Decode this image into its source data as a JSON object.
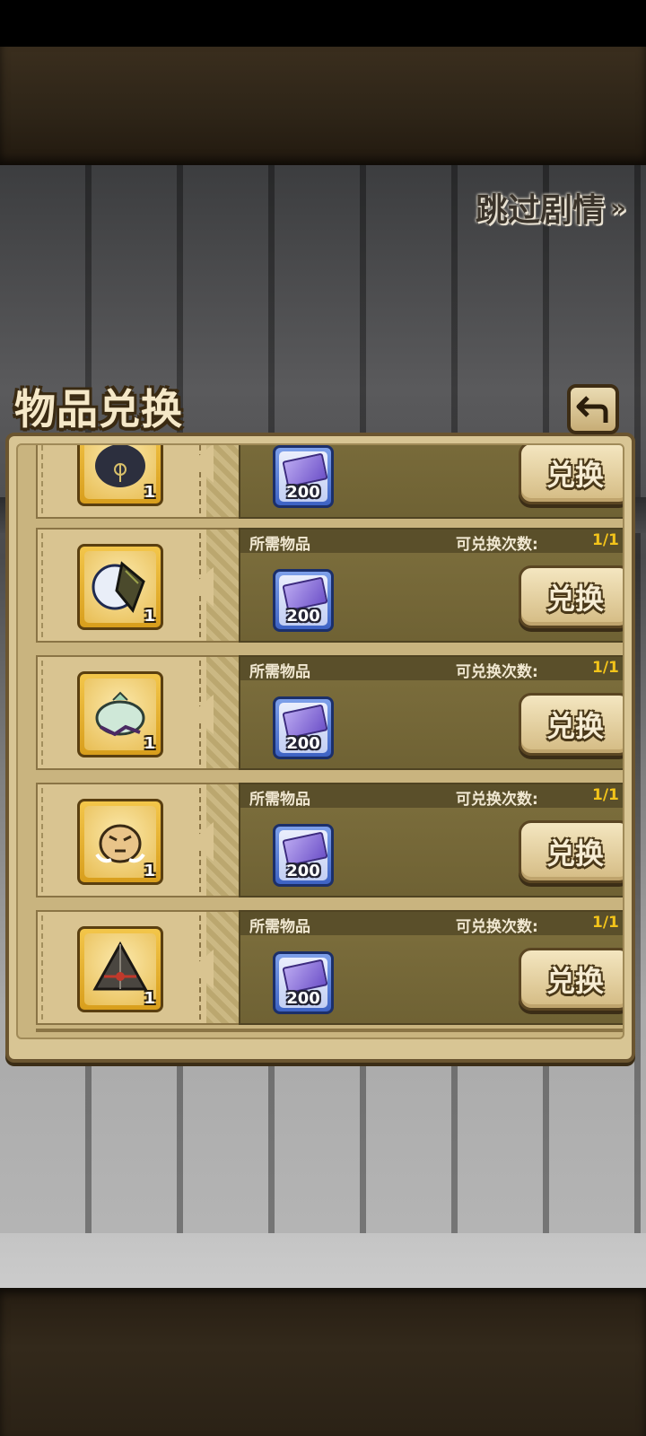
{
  "skip_story": {
    "label": "跳过剧情",
    "arrow": "»"
  },
  "panel": {
    "title": "物品兑换"
  },
  "row_labels": {
    "required": "所需物品",
    "exchange_count": "可兑换次数:",
    "exchange_button": "兑换"
  },
  "rows": [
    {
      "item_qty": "1",
      "cost_qty": "200",
      "count": "",
      "partial": true
    },
    {
      "item_qty": "1",
      "cost_qty": "200",
      "count": "1/1"
    },
    {
      "item_qty": "1",
      "cost_qty": "200",
      "count": "1/1"
    },
    {
      "item_qty": "1",
      "cost_qty": "200",
      "count": "1/1"
    },
    {
      "item_qty": "1",
      "cost_qty": "200",
      "count": "1/1"
    }
  ],
  "colors": {
    "count_value": "#f3c41a",
    "panel_bg": "#d8c594",
    "row_main": "#7d6f3d"
  },
  "icons": [
    "pearl-shell-icon",
    "jade-crystal-icon",
    "tiger-mask-icon",
    "pyramid-icon",
    "ticket-icon"
  ]
}
